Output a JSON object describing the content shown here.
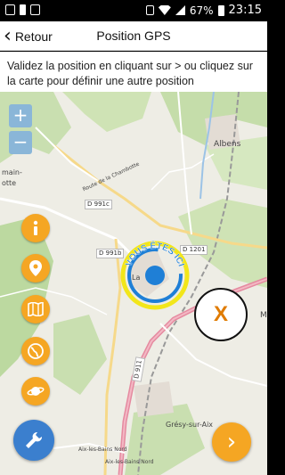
{
  "status_bar": {
    "battery": "67%",
    "time": "23:15"
  },
  "header": {
    "back_label": "Retour",
    "title": "Position GPS"
  },
  "instructions": "Validez la position en cliquant sur > ou cliquez sur la carte pour définir une autre position",
  "map": {
    "zoom_in": "+",
    "zoom_out": "−",
    "place_labels": [
      "main-",
      "otte",
      "Route de la Chambotte",
      "Albens",
      "D 991c",
      "D 991b",
      "D 1201",
      "La",
      "Grésy-sur-Aix",
      "Aix-les-Bains Nord",
      "Aix-les-Bains Nord",
      "D 911",
      "M"
    ],
    "marker_label": "VOUS ÊTES ICI",
    "target_label": "X"
  },
  "side_buttons": [
    "info-icon",
    "location-pin-icon",
    "map-icon",
    "globe-icon",
    "planet-icon"
  ],
  "tools_button": "wrench-icon",
  "next_button": "›",
  "colors": {
    "accent_orange": "#f5a623",
    "tools_blue": "#3b7fce",
    "marker_yellow": "#f2e61a",
    "marker_blue": "#1f7fd6"
  }
}
